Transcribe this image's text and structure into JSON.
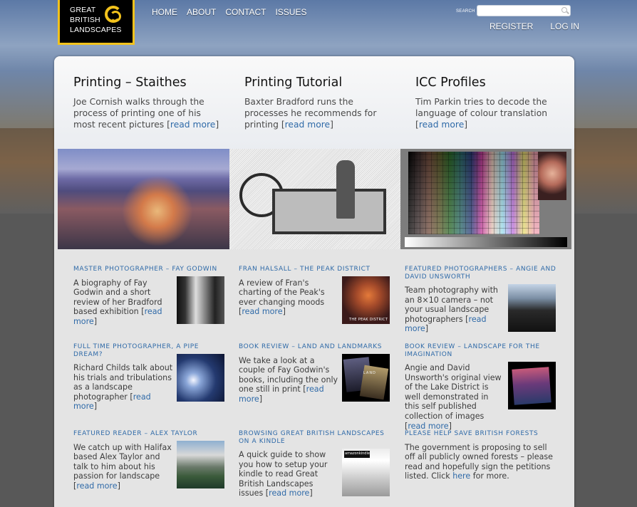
{
  "site": {
    "logo_lines": [
      "GREAT",
      "BRITISH",
      "LANDSCAPES"
    ],
    "accent_color": "#f2c21c",
    "link_color": "#2f6aa8"
  },
  "nav": [
    "HOME",
    "ABOUT",
    "CONTACT",
    "ISSUES"
  ],
  "search": {
    "label": "SEARCH",
    "value": "",
    "placeholder": ""
  },
  "account": {
    "register": "REGISTER",
    "login": "LOG IN"
  },
  "hero": [
    {
      "title": "Printing – Staithes",
      "text": "Joe Cornish walks through the process of printing one of his most recent pictures",
      "more": "read more"
    },
    {
      "title": "Printing Tutorial",
      "text": "Baxter Bradford runs the processes he recommends for printing",
      "more": "read more"
    },
    {
      "title": "ICC Profiles",
      "text": "Tim Parkin tries to decode the language of colour translation",
      "more": "read more"
    }
  ],
  "items": [
    {
      "heading": "MASTER PHOTOGRAPHER – FAY GODWIN",
      "text": "A biography of Fay Godwin and a short review of her Bradford based exhibition",
      "more": "read more",
      "icon": "fay-godwin-thumbnail"
    },
    {
      "heading": "FRAN HALSALL – THE PEAK DISTRICT",
      "text": "A review of Fran's charting of the Peak's ever changing moods",
      "more": "read more",
      "icon": "peak-district-thumbnail",
      "thumb_text": "THE PEAK DISTRICT"
    },
    {
      "heading": "FEATURED PHOTOGRAPHERS – ANGIE AND DAVID UNSWORTH",
      "text": "Team photography with an 8×10 camera – not your usual landscape photographers",
      "more": "read more",
      "icon": "unsworth-thumbnail"
    },
    {
      "heading": "FULL TIME PHOTOGRAPHER, A PIPE DREAM?",
      "text": "Richard Childs talk about his trials and tribulations as a landscape photographer",
      "more": "read more",
      "icon": "childs-thumbnail"
    },
    {
      "heading": "BOOK REVIEW – LAND AND LANDMARKS",
      "text": "We take a look at a couple of Fay Godwin's books, including the only one still in print",
      "more": "read more",
      "icon": "godwin-books-thumbnail",
      "thumb_text": "LAND"
    },
    {
      "heading": "BOOK REVIEW – LANDSCAPE FOR THE IMAGINATION",
      "text": "Angie and David Unsworth's original view of the Lake District is well demonstrated in this self published collection of images",
      "more": "read more",
      "icon": "lake-district-book-thumbnail"
    },
    {
      "heading": "FEATURED READER – ALEX TAYLOR",
      "text": "We catch up with Halifax based Alex Taylor and talk to him about his passion for landscape",
      "more": "read more",
      "icon": "alex-taylor-thumbnail"
    },
    {
      "heading": "BROWSING GREAT BRITISH LANDSCAPES ON A KINDLE",
      "text": "A quick guide to show you how to setup your kindle to read Great British Landscapes issues",
      "more": "read more",
      "icon": "kindle-thumbnail",
      "thumb_text": "amazonkindle"
    },
    {
      "heading": "PLEASE HELP SAVE BRITISH FORESTS",
      "text": "The government is proposing to sell off all publicly owned forests – please read and hopefully sign the petitions listed. Click",
      "more": "here",
      "tail": " for more."
    }
  ]
}
